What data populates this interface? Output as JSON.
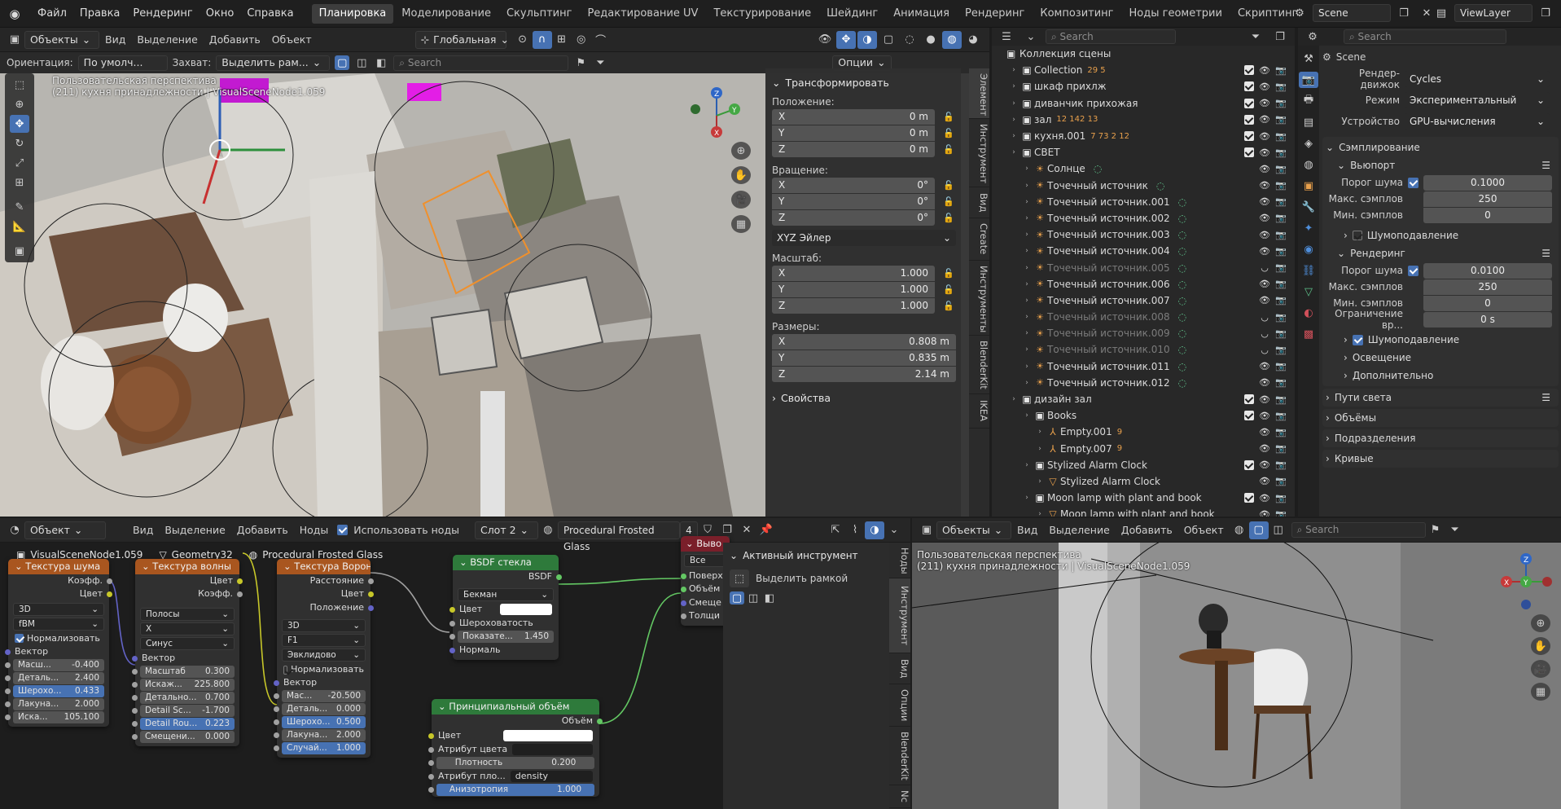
{
  "topbar": {
    "menus": [
      "Файл",
      "Правка",
      "Рендеринг",
      "Окно",
      "Справка"
    ],
    "workspaces": [
      "Планировка",
      "Моделирование",
      "Скульптинг",
      "Редактирование UV",
      "Текстурирование",
      "Шейдинг",
      "Анимация",
      "Рендеринг",
      "Композитинг",
      "Ноды геометрии",
      "Скриптинг"
    ],
    "active_workspace": "Планировка",
    "scene": "Scene",
    "view_layer": "ViewLayer"
  },
  "viewport": {
    "mode": "Объекты",
    "menus": [
      "Вид",
      "Выделение",
      "Добавить",
      "Объект"
    ],
    "transform_orientation": "Глобальная",
    "orientation_label": "Ориентация:",
    "orientation_value": "По умолч...",
    "drag_label": "Захват:",
    "drag_value": "Выделить рам...",
    "search_placeholder": "Search",
    "options": "Опции",
    "overlay_title": "Пользовательская перспектива",
    "overlay_sub": "(211) кухня принадлежности | VisualSceneNode1.059"
  },
  "npanel": {
    "title": "Трансформировать",
    "location_label": "Положение:",
    "location": [
      {
        "axis": "X",
        "value": "0 m"
      },
      {
        "axis": "Y",
        "value": "0 m"
      },
      {
        "axis": "Z",
        "value": "0 m"
      }
    ],
    "rotation_label": "Вращение:",
    "rotation": [
      {
        "axis": "X",
        "value": "0°"
      },
      {
        "axis": "Y",
        "value": "0°"
      },
      {
        "axis": "Z",
        "value": "0°"
      }
    ],
    "rotation_mode": "XYZ Эйлер",
    "scale_label": "Масштаб:",
    "scale": [
      {
        "axis": "X",
        "value": "1.000"
      },
      {
        "axis": "Y",
        "value": "1.000"
      },
      {
        "axis": "Z",
        "value": "1.000"
      }
    ],
    "dims_label": "Размеры:",
    "dims": [
      {
        "axis": "X",
        "value": "0.808 m"
      },
      {
        "axis": "Y",
        "value": "0.835 m"
      },
      {
        "axis": "Z",
        "value": "2.14 m"
      }
    ],
    "properties": "Свойства",
    "tabs": [
      "Элемент",
      "Инструмент",
      "Вид",
      "Create",
      "Инструменты",
      "BlenderKit",
      "IKEA"
    ]
  },
  "outliner": {
    "search_placeholder": "Search",
    "root": "Коллекция сцены",
    "items": [
      {
        "name": "Collection",
        "indent": 1,
        "badge": "29 5"
      },
      {
        "name": "шкаф прихлж",
        "indent": 1,
        "badge": ""
      },
      {
        "name": "диванчик прихожая",
        "indent": 1,
        "badge": ""
      },
      {
        "name": "зал",
        "indent": 1,
        "badge": "12 142 13"
      },
      {
        "name": "кухня.001",
        "indent": 1,
        "badge": "7 73 2 12"
      },
      {
        "name": "СВЕТ",
        "indent": 1,
        "badge": ""
      },
      {
        "name": "Солнце",
        "indent": 2,
        "badge": ""
      },
      {
        "name": "Точечный источник",
        "indent": 2,
        "badge": ""
      },
      {
        "name": "Точечный источник.001",
        "indent": 2,
        "badge": ""
      },
      {
        "name": "Точечный источник.002",
        "indent": 2,
        "badge": ""
      },
      {
        "name": "Точечный источник.003",
        "indent": 2,
        "badge": ""
      },
      {
        "name": "Точечный источник.004",
        "indent": 2,
        "badge": ""
      },
      {
        "name": "Точечный источник.005",
        "indent": 2,
        "badge": "",
        "dim": true
      },
      {
        "name": "Точечный источник.006",
        "indent": 2,
        "badge": ""
      },
      {
        "name": "Точечный источник.007",
        "indent": 2,
        "badge": ""
      },
      {
        "name": "Точечный источник.008",
        "indent": 2,
        "badge": "",
        "dim": true
      },
      {
        "name": "Точечный источник.009",
        "indent": 2,
        "badge": "",
        "dim": true
      },
      {
        "name": "Точечный источник.010",
        "indent": 2,
        "badge": "",
        "dim": true
      },
      {
        "name": "Точечный источник.011",
        "indent": 2,
        "badge": ""
      },
      {
        "name": "Точечный источник.012",
        "indent": 2,
        "badge": ""
      },
      {
        "name": "дизайн зал",
        "indent": 1,
        "badge": ""
      },
      {
        "name": "Books",
        "indent": 2,
        "badge": ""
      },
      {
        "name": "Empty.001",
        "indent": 3,
        "badge": "9"
      },
      {
        "name": "Empty.007",
        "indent": 3,
        "badge": "9"
      },
      {
        "name": "Stylized Alarm Clock",
        "indent": 2,
        "badge": ""
      },
      {
        "name": "Stylized Alarm Clock",
        "indent": 3,
        "badge": ""
      },
      {
        "name": "Moon lamp with plant and book",
        "indent": 2,
        "badge": ""
      },
      {
        "name": "Moon lamp with plant and book",
        "indent": 3,
        "badge": ""
      }
    ]
  },
  "properties": {
    "search_placeholder": "Search",
    "scene_name": "Scene",
    "render_engine_label": "Рендер-движок",
    "render_engine": "Cycles",
    "mode_label": "Режим",
    "mode": "Экспериментальный",
    "device_label": "Устройство",
    "device": "GPU-вычисления",
    "sampling": "Сэмплирование",
    "viewport": "Вьюпорт",
    "noise_threshold_label": "Порог шума",
    "vp_noise": "0.1000",
    "max_samples_label": "Макс. сэмплов",
    "vp_max": "250",
    "min_samples_label": "Мин. сэмплов",
    "vp_min": "0",
    "denoise": "Шумоподавление",
    "render": "Рендеринг",
    "r_noise": "0.0100",
    "r_max": "250",
    "r_min": "0",
    "time_limit_label": "Ограничение вр...",
    "time_limit": "0 s",
    "r_denoise": "Шумоподавление",
    "lights": "Освещение",
    "advanced": "Дополнительно",
    "light_paths": "Пути света",
    "volumes": "Объёмы",
    "subdivision": "Подразделения",
    "curves": "Кривые"
  },
  "node_editor": {
    "mode": "Объект",
    "menus": [
      "Вид",
      "Выделение",
      "Добавить",
      "Ноды"
    ],
    "use_nodes": "Использовать ноды",
    "slot": "Слот 2",
    "material": "Procedural Frosted Glass",
    "users": "4",
    "breadcrumb": [
      "VisualSceneNode1.059",
      "Geometry32",
      "Procedural Frosted Glass"
    ],
    "active_tool_title": "Активный инструмент",
    "active_tool": "Выделить рамкой",
    "tabs": [
      "Ноды",
      "Инструмент",
      "Вид",
      "Опции",
      "BlenderKit",
      "Nc"
    ],
    "noise_node": {
      "title": "Текстура шума",
      "out1": "Коэфф.",
      "out2": "Цвет",
      "dim": "3D",
      "type": "fBM",
      "normalize": "Нормализовать",
      "vector": "Вектор",
      "fields": [
        {
          "l": "Масш...",
          "v": "-0.400"
        },
        {
          "l": "Деталь...",
          "v": "2.400"
        },
        {
          "l": "Шерохо...",
          "v": "0.433"
        },
        {
          "l": "Лакуна...",
          "v": "2.000"
        },
        {
          "l": "Иска...",
          "v": "105.100"
        }
      ]
    },
    "wave_node": {
      "title": "Текстура волны",
      "out1": "Цвет",
      "out2": "Коэфф.",
      "type": "Полосы",
      "axis": "X",
      "profile": "Синус",
      "vector": "Вектор",
      "fields": [
        {
          "l": "Масштаб",
          "v": "0.300"
        },
        {
          "l": "Искаж...",
          "v": "225.800"
        },
        {
          "l": "Детально...",
          "v": "0.700"
        },
        {
          "l": "Detail Sc...",
          "v": "-1.700"
        },
        {
          "l": "Detail Rou...",
          "v": "0.223"
        },
        {
          "l": "Смещени...",
          "v": "0.000"
        }
      ]
    },
    "voronoi_node": {
      "title": "Текстура Вороного",
      "out1": "Расстояние",
      "out2": "Цвет",
      "out3": "Положение",
      "dim": "3D",
      "feature": "F1",
      "metric": "Эвклидово",
      "normalize": "Нормализовать",
      "vector": "Вектор",
      "fields": [
        {
          "l": "Мас...",
          "v": "-20.500"
        },
        {
          "l": "Деталь...",
          "v": "0.000"
        },
        {
          "l": "Шерохо...",
          "v": "0.500"
        },
        {
          "l": "Лакуна...",
          "v": "2.000"
        },
        {
          "l": "Случай...",
          "v": "1.000"
        }
      ]
    },
    "glass_node": {
      "title": "BSDF стекла",
      "out": "BSDF",
      "dist": "Бекман",
      "color": "Цвет",
      "rough": "Шероховатость",
      "ior_label": "Показате...",
      "ior": "1.450",
      "normal": "Нормаль"
    },
    "volume_node": {
      "title": "Принципиальный объём",
      "out": "Объём",
      "color": "Цвет",
      "color_attr": "Атрибут цвета",
      "density_label": "Плотность",
      "density": "0.200",
      "density_attr_label": "Атрибут пло...",
      "density_attr": "density",
      "aniso_label": "Анизотропия",
      "aniso": "1.000"
    },
    "output_node": {
      "title": "Выво",
      "target": "Все",
      "in1": "Поверх",
      "in2": "Объём",
      "in3": "Смеще",
      "in4": "Толщи"
    }
  },
  "viewport2": {
    "mode": "Объекты",
    "menus": [
      "Вид",
      "Выделение",
      "Добавить",
      "Объект"
    ],
    "search_placeholder": "Search",
    "overlay_title": "Пользовательская перспектива",
    "overlay_sub": "(211) кухня принадлежности | VisualSceneNode1.059"
  },
  "colors": {
    "accent": "#4772b3",
    "texture_header": "#a9561f",
    "shader_header": "#2e7a3b",
    "light_icon": "#e8a04c"
  }
}
